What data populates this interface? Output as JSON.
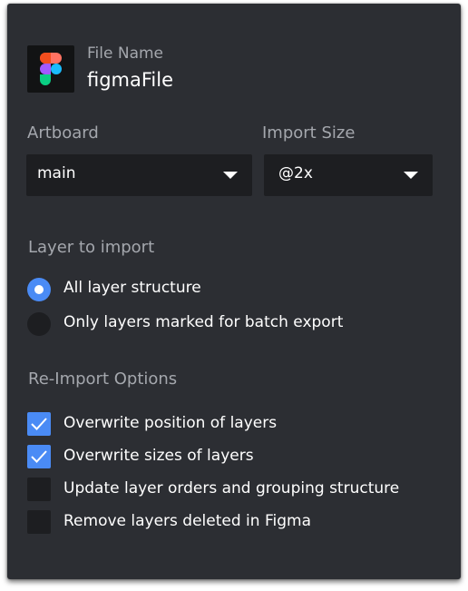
{
  "file": {
    "label": "File Name",
    "name": "figmaFile",
    "icon": "figma-logo-icon"
  },
  "artboard": {
    "label": "Artboard",
    "value": "main"
  },
  "import_size": {
    "label": "Import Size",
    "value": "@2x"
  },
  "layer_import": {
    "label": "Layer to import",
    "options": [
      {
        "label": "All layer structure",
        "checked": true
      },
      {
        "label": "Only layers marked for batch export",
        "checked": false
      }
    ]
  },
  "reimport": {
    "label": "Re-Import Options",
    "options": [
      {
        "label": "Overwrite position of layers",
        "checked": true
      },
      {
        "label": "Overwrite sizes of layers",
        "checked": true
      },
      {
        "label": "Update layer orders and grouping structure",
        "checked": false
      },
      {
        "label": "Remove layers deleted in Figma",
        "checked": false
      }
    ]
  },
  "colors": {
    "panel": "#2c2e33",
    "field": "#1d1e21",
    "accent": "#4a8bf5",
    "label": "#a4a7ad",
    "text": "#ffffff"
  }
}
